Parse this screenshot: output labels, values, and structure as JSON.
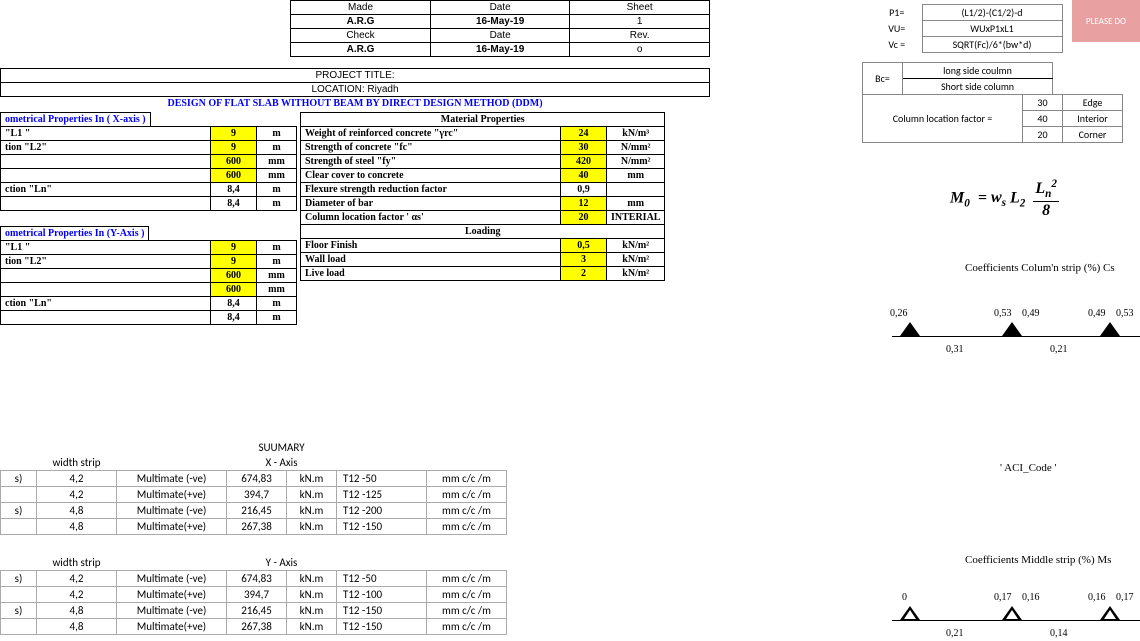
{
  "header": {
    "made_lbl": "Made",
    "made_val": "A.R.G",
    "check_lbl": "Check",
    "check_val": "A.R.G",
    "date_lbl": "Date",
    "date1": "16-May-19",
    "date2": "16-May-19",
    "sheet_lbl": "Sheet",
    "sheet_val": "1",
    "rev_lbl": "Rev.",
    "rev_val": "o"
  },
  "project": {
    "title_lbl": "PROJECT TITLE:",
    "loc_lbl": "LOCATION:",
    "loc_val": "Riyadh"
  },
  "design_title": "DESIGN OF FLAT SLAB WITHOUT BEAM BY DIRECT DESIGN METHOD (DDM)",
  "xprops": {
    "header": "ometrical Properties In ( X-axis )",
    "rows": [
      {
        "lbl": "\"L1 \"",
        "val": "9",
        "unit": "m"
      },
      {
        "lbl": "tion \"L2\"",
        "val": "9",
        "unit": "m"
      },
      {
        "lbl": "",
        "val": "600",
        "unit": "mm"
      },
      {
        "lbl": "",
        "val": "600",
        "unit": "mm"
      },
      {
        "lbl": "ction \"Ln\"",
        "val": "8,4",
        "unit": "m"
      },
      {
        "lbl": "",
        "val": "8,4",
        "unit": "m"
      }
    ]
  },
  "yprops": {
    "header": "ometrical Properties In (Y-Axis )",
    "rows": [
      {
        "lbl": "\"L1 \"",
        "val": "9",
        "unit": "m"
      },
      {
        "lbl": "tion \"L2\"",
        "val": "9",
        "unit": "m"
      },
      {
        "lbl": "",
        "val": "600",
        "unit": "mm"
      },
      {
        "lbl": "",
        "val": "600",
        "unit": "mm"
      },
      {
        "lbl": "ction \"Ln\"",
        "val": "8,4",
        "unit": "m"
      },
      {
        "lbl": "",
        "val": "8,4",
        "unit": "m"
      }
    ]
  },
  "mat": {
    "header": "Material Properties",
    "rows": [
      {
        "lbl": "Weight of reinforced concrete \"γrc\"",
        "val": "24",
        "unit": "kN/m³",
        "yellow": true
      },
      {
        "lbl": "Strength of concrete \"fc\"",
        "val": "30",
        "unit": "N/mm²",
        "yellow": true
      },
      {
        "lbl": "Strength of steel \"fy\"",
        "val": "420",
        "unit": "N/mm²",
        "yellow": true
      },
      {
        "lbl": "Clear cover to concrete",
        "val": "40",
        "unit": "mm",
        "yellow": true
      },
      {
        "lbl": "Flexure strength reduction factor",
        "val": "0,9",
        "unit": "",
        "yellow": false
      },
      {
        "lbl": "Diameter of bar",
        "val": "12",
        "unit": "mm",
        "yellow": true
      },
      {
        "lbl": "Column location factor  ' αs'",
        "val": "20",
        "unit": "INTERIAL",
        "yellow": true
      }
    ],
    "load_hdr": "Loading",
    "loads": [
      {
        "lbl": "Floor Finish",
        "val": "0,5",
        "unit": "kN/m²"
      },
      {
        "lbl": "Wall load",
        "val": "3",
        "unit": "kN/m²"
      },
      {
        "lbl": "Live load",
        "val": "2",
        "unit": "kN/m²"
      }
    ]
  },
  "summary": {
    "title": "SUUMARY",
    "width_lbl": "width strip",
    "xaxis": "X - Axis",
    "yaxis": "Y - Axis",
    "rows_x": [
      {
        "c0": "s)",
        "w": "4,2",
        "m": "Multimate (-ve)",
        "v": "674,83",
        "u": "kN.m",
        "t": "T12  -50",
        "cc": "mm c/c /m"
      },
      {
        "c0": "",
        "w": "4,2",
        "m": "Multimate(+ve)",
        "v": "394,7",
        "u": "kN.m",
        "t": "T12  -125",
        "cc": "mm c/c /m"
      },
      {
        "c0": "s)",
        "w": "4,8",
        "m": "Multimate (-ve)",
        "v": "216,45",
        "u": "kN.m",
        "t": "T12  -200",
        "cc": "mm c/c /m"
      },
      {
        "c0": "",
        "w": "4,8",
        "m": "Multimate(+ve)",
        "v": "267,38",
        "u": "kN.m",
        "t": "T12  -150",
        "cc": "mm c/c /m"
      }
    ],
    "rows_y": [
      {
        "c0": "s)",
        "w": "4,2",
        "m": "Multimate (-ve)",
        "v": "674,83",
        "u": "kN.m",
        "t": "T12  -50",
        "cc": "mm c/c /m"
      },
      {
        "c0": "",
        "w": "4,2",
        "m": "Multimate(+ve)",
        "v": "394,7",
        "u": "kN.m",
        "t": "T12  -100",
        "cc": "mm c/c /m"
      },
      {
        "c0": "s)",
        "w": "4,8",
        "m": "Multimate (-ve)",
        "v": "216,45",
        "u": "kN.m",
        "t": "T12  -150",
        "cc": "mm c/c /m"
      },
      {
        "c0": "",
        "w": "4,8",
        "m": "Multimate(+ve)",
        "v": "267,38",
        "u": "kN.m",
        "t": "T12  -150",
        "cc": "mm c/c /m"
      }
    ]
  },
  "right": {
    "please": "PLEASE DO",
    "defs": [
      {
        "k": "P1=",
        "v": "(L1/2)-(C1/2)-d"
      },
      {
        "k": "VU=",
        "v": "WUxP1xL1"
      },
      {
        "k": "Vc =",
        "v": "SQRT(Fc)/6*(bw*d)"
      }
    ],
    "bc": {
      "lbl": "Bc=",
      "top": "long side coulmn",
      "bot": "Short side column"
    },
    "clf": {
      "lbl": "Column location factor =",
      "rows": [
        {
          "v": "30",
          "t": "Edge"
        },
        {
          "v": "40",
          "t": "Interior"
        },
        {
          "v": "20",
          "t": "Corner"
        }
      ]
    },
    "formula": "M₀ = wₛ L₂ (Lₙ² / 8)",
    "coef_cs": "Coefficients Colum'n strip (%)    Cs",
    "coef_ms": "Coefficients Middle strip (%)    Ms",
    "aci": "' ACI_Code '",
    "cs_vals": {
      "a": "0,26",
      "b": "0,53",
      "c": "0,49",
      "d": "0,49",
      "e": "0,53",
      "mid1": "0,31",
      "mid2": "0,21"
    },
    "ms_vals": {
      "a": "0",
      "b": "0,17",
      "c": "0,16",
      "d": "0,16",
      "e": "0,17",
      "mid1": "0,21",
      "mid2": "0,14"
    }
  }
}
